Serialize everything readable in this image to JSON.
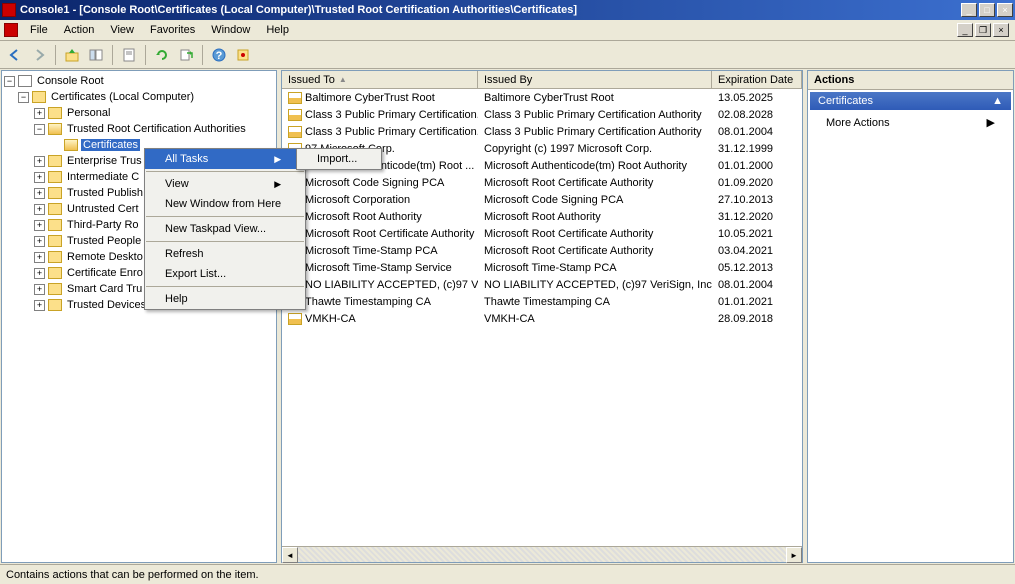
{
  "titlebar": {
    "text": "Console1 - [Console Root\\Certificates (Local Computer)\\Trusted Root Certification Authorities\\Certificates]"
  },
  "menubar": {
    "items": [
      "File",
      "Action",
      "View",
      "Favorites",
      "Window",
      "Help"
    ]
  },
  "tree": {
    "root": "Console Root",
    "cert_root": "Certificates (Local Computer)",
    "folders": [
      "Personal",
      "Trusted Root Certification Authorities",
      "Certificates",
      "Enterprise Trus",
      "Intermediate C",
      "Trusted Publish",
      "Untrusted Cert",
      "Third-Party Ro",
      "Trusted People",
      "Remote Deskto",
      "Certificate Enro",
      "Smart Card Tru",
      "Trusted Devices"
    ]
  },
  "columns": {
    "issued_to": "Issued To",
    "issued_by": "Issued By",
    "expiration": "Expiration Date"
  },
  "certs": [
    {
      "to": "Baltimore CyberTrust Root",
      "by": "Baltimore CyberTrust Root",
      "exp": "13.05.2025"
    },
    {
      "to": "Class 3 Public Primary Certification...",
      "by": "Class 3 Public Primary Certification Authority",
      "exp": "02.08.2028"
    },
    {
      "to": "Class 3 Public Primary Certification...",
      "by": "Class 3 Public Primary Certification Authority",
      "exp": "08.01.2004"
    },
    {
      "to": "97 Microsoft Corp.",
      "by": "Copyright (c) 1997 Microsoft Corp.",
      "exp": "31.12.1999"
    },
    {
      "to": "Microsoft Authenticode(tm) Root ...",
      "by": "Microsoft Authenticode(tm) Root Authority",
      "exp": "01.01.2000"
    },
    {
      "to": "Microsoft Code Signing PCA",
      "by": "Microsoft Root Certificate Authority",
      "exp": "01.09.2020"
    },
    {
      "to": "Microsoft Corporation",
      "by": "Microsoft Code Signing PCA",
      "exp": "27.10.2013"
    },
    {
      "to": "Microsoft Root Authority",
      "by": "Microsoft Root Authority",
      "exp": "31.12.2020"
    },
    {
      "to": "Microsoft Root Certificate Authority",
      "by": "Microsoft Root Certificate Authority",
      "exp": "10.05.2021"
    },
    {
      "to": "Microsoft Time-Stamp PCA",
      "by": "Microsoft Root Certificate Authority",
      "exp": "03.04.2021"
    },
    {
      "to": "Microsoft Time-Stamp Service",
      "by": "Microsoft Time-Stamp PCA",
      "exp": "05.12.2013"
    },
    {
      "to": "NO LIABILITY ACCEPTED, (c)97 V...",
      "by": "NO LIABILITY ACCEPTED, (c)97 VeriSign, Inc.",
      "exp": "08.01.2004"
    },
    {
      "to": "Thawte Timestamping CA",
      "by": "Thawte Timestamping CA",
      "exp": "01.01.2021"
    },
    {
      "to": "VMKH-CA",
      "by": "VMKH-CA",
      "exp": "28.09.2018"
    }
  ],
  "actions": {
    "header": "Actions",
    "section": "Certificates",
    "more": "More Actions"
  },
  "context_menu": {
    "all_tasks": "All Tasks",
    "view": "View",
    "new_window": "New Window from Here",
    "new_taskpad": "New Taskpad View...",
    "refresh": "Refresh",
    "export_list": "Export List...",
    "help": "Help",
    "import": "Import..."
  },
  "statusbar": "Contains actions that can be performed on the item."
}
